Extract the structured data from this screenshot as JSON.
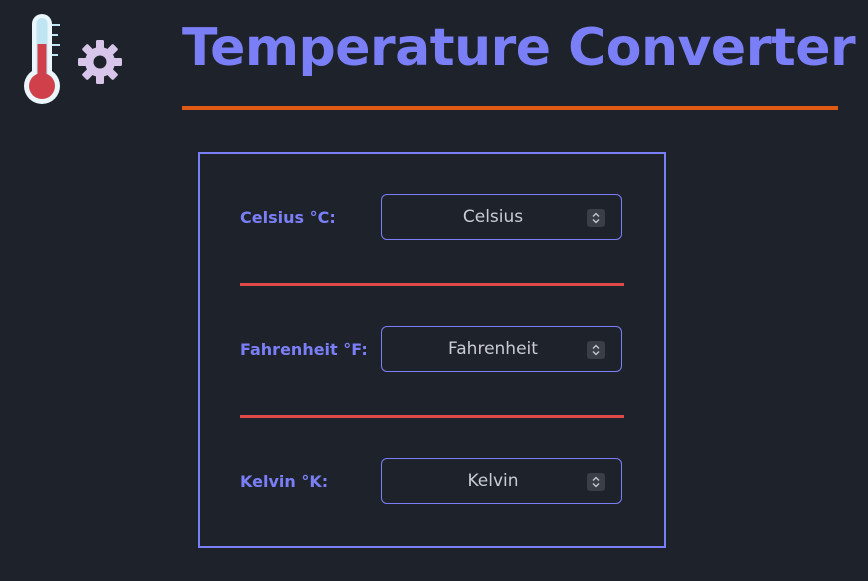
{
  "header": {
    "title": "Temperature Converter",
    "logo_icon": "thermometer-gear-icon"
  },
  "converter": {
    "fields": [
      {
        "label": "Celsius °C:",
        "placeholder": "Celsius",
        "value": ""
      },
      {
        "label": "Fahrenheit °F:",
        "placeholder": "Fahrenheit",
        "value": ""
      },
      {
        "label": "Kelvin °K:",
        "placeholder": "Kelvin",
        "value": ""
      }
    ],
    "spinner_icon": "number-stepper-icon"
  },
  "colors": {
    "background": "#1e232b",
    "accent": "#7b7ff7",
    "title_underline": "#e05a16",
    "separator": "#e04a4a",
    "thermometer_red": "#d0404a",
    "gear": "#d8c6ea"
  }
}
